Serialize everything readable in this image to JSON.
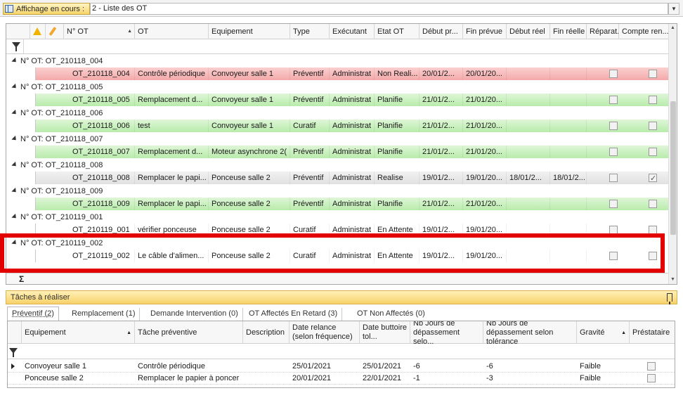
{
  "topbar": {
    "view_label": "Affichage en cours :",
    "view_value": "2 - Liste des OT"
  },
  "grid": {
    "columns": [
      "N° OT",
      "OT",
      "Equipement",
      "Type",
      "Exécutant",
      "Etat OT",
      "Début pr...",
      "Fin prévue",
      "Début réel",
      "Fin réelle",
      "Réparat...",
      "Compte ren..."
    ],
    "group_prefix": "N° OT:",
    "groups": [
      {
        "id": "OT_210118_004",
        "style": "red",
        "ot": "OT_210118_004",
        "desc": "Contrôle périodique",
        "equip": "Convoyeur salle 1",
        "type": "Préventif",
        "exec": "Administrat",
        "etat": "Non Reali...",
        "debut_prevu": "20/01/2...",
        "fin_prevue": "20/01/20...",
        "debut_reel": "",
        "fin_reelle": "",
        "reparat": false,
        "compte": false
      },
      {
        "id": "OT_210118_005",
        "style": "green",
        "ot": "OT_210118_005",
        "desc": "Remplacement d...",
        "equip": "Convoyeur salle 1",
        "type": "Préventif",
        "exec": "Administrat",
        "etat": "Planifie",
        "debut_prevu": "21/01/2...",
        "fin_prevue": "21/01/20...",
        "debut_reel": "",
        "fin_reelle": "",
        "reparat": false,
        "compte": false
      },
      {
        "id": "OT_210118_006",
        "style": "green",
        "ot": "OT_210118_006",
        "desc": "test",
        "equip": "Convoyeur salle 1",
        "type": "Curatif",
        "exec": "Administrat",
        "etat": "Planifie",
        "debut_prevu": "21/01/2...",
        "fin_prevue": "21/01/20...",
        "debut_reel": "",
        "fin_reelle": "",
        "reparat": false,
        "compte": false
      },
      {
        "id": "OT_210118_007",
        "style": "green",
        "ot": "OT_210118_007",
        "desc": "Remplacement d...",
        "equip": "Moteur asynchrone 2(",
        "type": "Préventif",
        "exec": "Administrat",
        "etat": "Planifie",
        "debut_prevu": "21/01/2...",
        "fin_prevue": "21/01/20...",
        "debut_reel": "",
        "fin_reelle": "",
        "reparat": false,
        "compte": false
      },
      {
        "id": "OT_210118_008",
        "style": "grey",
        "ot": "OT_210118_008",
        "desc": "Remplacer le papi...",
        "equip": "Ponceuse salle 2",
        "type": "Préventif",
        "exec": "Administrat",
        "etat": "Realise",
        "debut_prevu": "19/01/2...",
        "fin_prevue": "19/01/20...",
        "debut_reel": "18/01/2...",
        "fin_reelle": "18/01/2...",
        "reparat": false,
        "compte": true
      },
      {
        "id": "OT_210118_009",
        "style": "green",
        "ot": "OT_210118_009",
        "desc": "Remplacer le papi...",
        "equip": "Ponceuse salle 2",
        "type": "Préventif",
        "exec": "Administrat",
        "etat": "Planifie",
        "debut_prevu": "21/01/2...",
        "fin_prevue": "21/01/20...",
        "debut_reel": "",
        "fin_reelle": "",
        "reparat": false,
        "compte": false
      },
      {
        "id": "OT_210119_001",
        "style": "white",
        "ot": "OT_210119_001",
        "desc": "vérifier ponceuse",
        "equip": "Ponceuse salle 2",
        "type": "Curatif",
        "exec": "Administrat",
        "etat": "En Attente",
        "debut_prevu": "19/01/2...",
        "fin_prevue": "19/01/20...",
        "debut_reel": "",
        "fin_reelle": "",
        "reparat": false,
        "compte": false
      },
      {
        "id": "OT_210119_002",
        "style": "white",
        "ot": "OT_210119_002",
        "desc": "Le câble d'alimen...",
        "equip": "Ponceuse salle 2",
        "type": "Curatif",
        "exec": "Administrat",
        "etat": "En Attente",
        "debut_prevu": "19/01/2...",
        "fin_prevue": "19/01/20...",
        "debut_reel": "",
        "fin_reelle": "",
        "reparat": false,
        "compte": false
      }
    ]
  },
  "panel": {
    "title": "Tâches à réaliser",
    "tabs": [
      "Préventif (2)",
      "Remplacement (1)",
      "Demande Intervention (0)",
      "OT Affectés En Retard (3)",
      "OT Non Affectés (0)"
    ],
    "columns": [
      "Equipement",
      "Tâche préventive",
      "Description",
      "Date relance (selon fréquence)",
      "Date buttoire tol...",
      "Nb Jours de dépassement selo...",
      "Nb Jours de dépassement selon tolérance",
      "Gravité",
      "Préstataire"
    ],
    "rows": [
      {
        "equip": "Convoyeur salle 1",
        "tache": "Contrôle périodique",
        "description": "",
        "date_relance": "25/01/2021",
        "date_butoire": "25/01/2021",
        "nb1": "-6",
        "nb2": "-6",
        "gravite": "Faible",
        "prestataire": false
      },
      {
        "equip": "Ponceuse salle 2",
        "tache": "Remplacer le papier à poncer",
        "description": "",
        "date_relance": "20/01/2021",
        "date_butoire": "22/01/2021",
        "nb1": "-1",
        "nb2": "-3",
        "gravite": "Faible",
        "prestataire": false
      }
    ]
  }
}
